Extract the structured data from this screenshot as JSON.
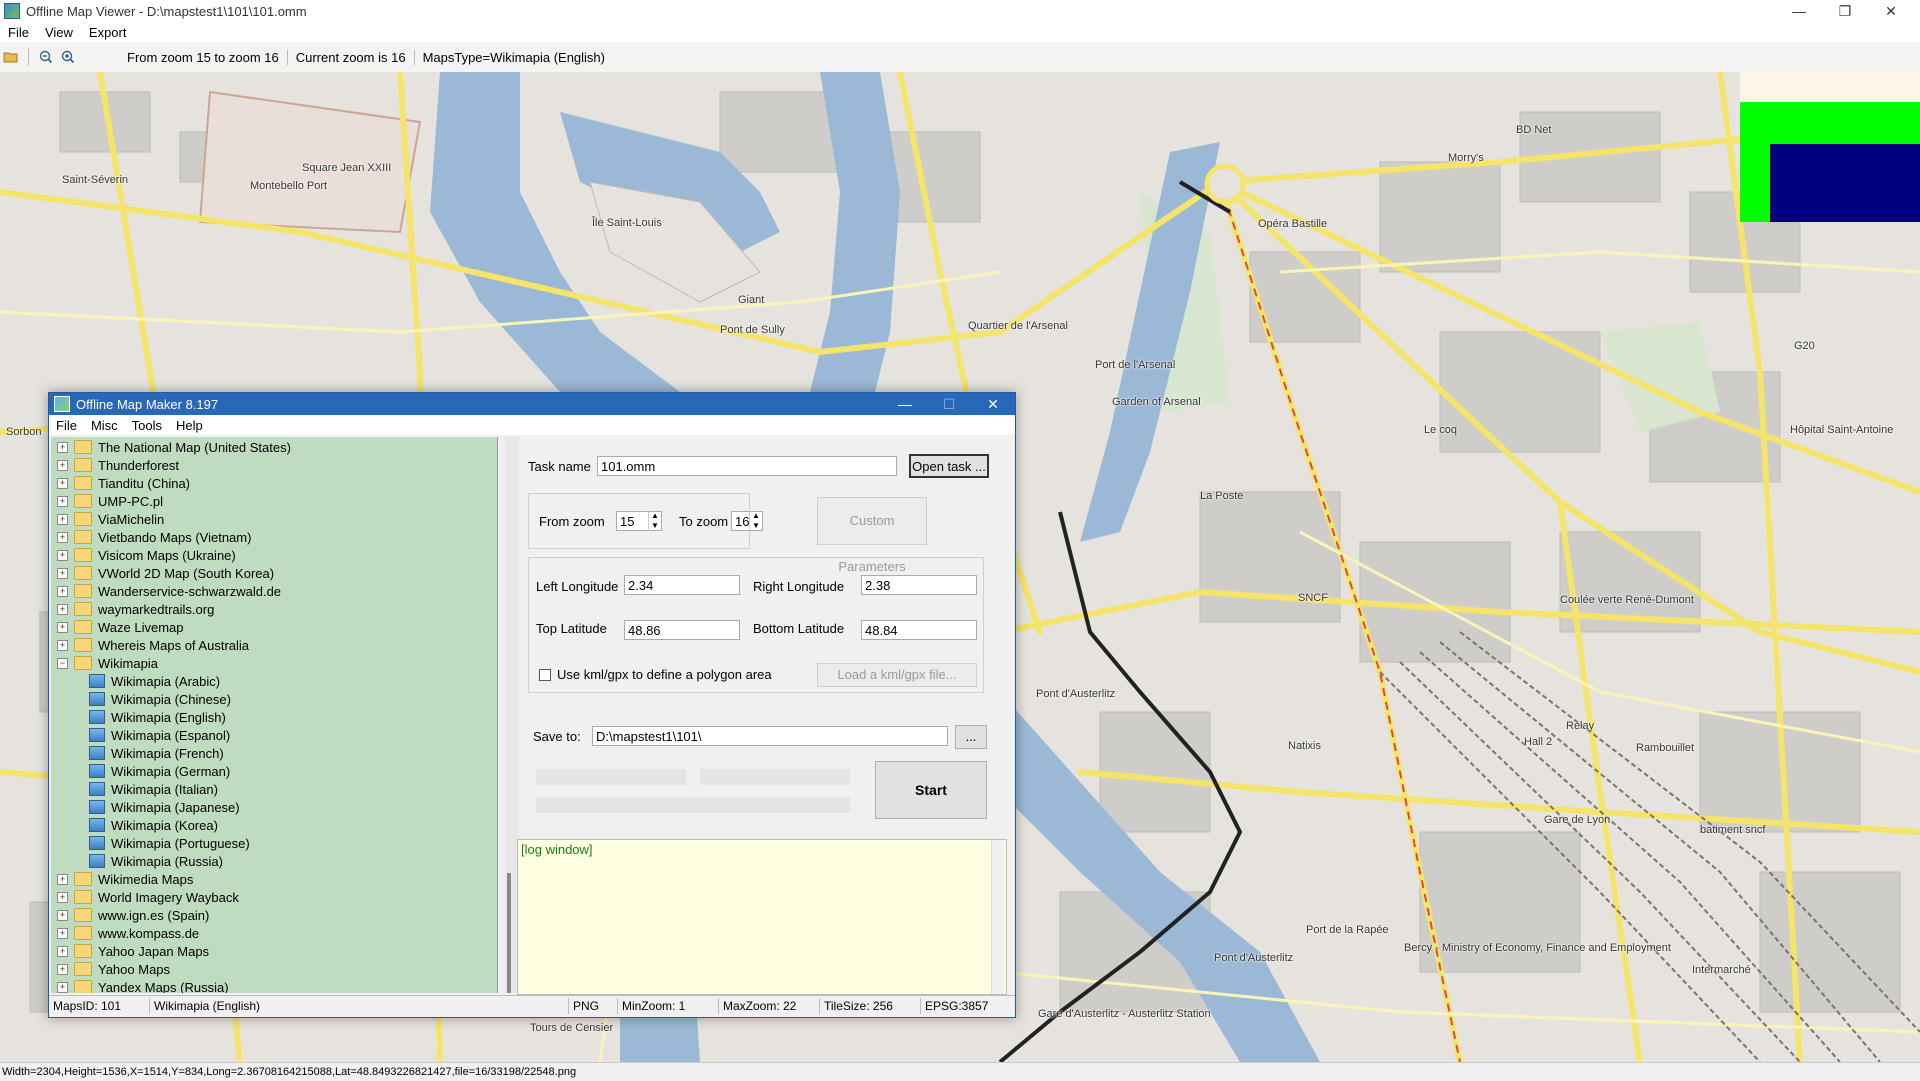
{
  "window": {
    "title": "Offline Map Viewer - D:\\mapstest1\\101\\101.omm",
    "minimize": "—",
    "maximize": "❐",
    "close": "✕"
  },
  "menu": [
    "File",
    "View",
    "Export"
  ],
  "toolbar": {
    "open_icon": "folder-open-icon",
    "zoom_out_icon": "zoom-out-icon",
    "zoom_in_icon": "zoom-in-icon",
    "zoom_range": "From zoom 15 to zoom 16",
    "current_zoom": "Current zoom is 16",
    "maps_type": "MapsType=Wikimapia (English)"
  },
  "map_labels": {
    "square_jean": "Square Jean XXIII",
    "saint_severin": "Saint-Séverin",
    "montebello": "Montebello Port",
    "ile_saint_louis": "Île Saint-Louis",
    "giant": "Giant",
    "pont_sully": "Pont de Sully",
    "quartier_arsenal": "Quartier de l'Arsenal",
    "port_arsenal": "Port de l'Arsenal",
    "garden_arsenal": "Garden of Arsenal",
    "opera_bastille": "Opéra Bastille",
    "bd_net": "BD Net",
    "morrys": "Morry's",
    "g20": "G20",
    "hopital": "Hôpital Saint-Antoine",
    "le_coq": "Le coq",
    "la_poste": "La Poste",
    "sncf": "SNCF",
    "coulee_verte": "Coulée verte René-Dumont",
    "pont_austerlitz_1": "Pont d'Austerlitz",
    "natixis": "Natixis",
    "relay": "Relay",
    "hall_2": "Hall 2",
    "rambouillet": "Rambouillet",
    "gare_lyon": "Gare de Lyon",
    "batiment": "batiment sncf",
    "port_rapee": "Port de la Rapée",
    "bercy": "Bercy - Ministry of Economy, Finance and Employment",
    "pont_austerlitz_2": "Pont d'Austerlitz",
    "intermarche": "Intermarché",
    "gare_austerlitz": "Gare d'Austerlitz - Austerlitz Station",
    "tours_censier": "Tours de Censier",
    "sorbonne": "Sorbon"
  },
  "status": "Width=2304,Height=1536,X=1514,Y=834,Long=2.36708164215088,Lat=48.8493226821427,file=16/33198/22548.png",
  "maker": {
    "title": "Offline Map Maker 8.197",
    "minimize": "—",
    "maximize": "☐",
    "close": "✕",
    "menu": [
      "File",
      "Misc",
      "Tools",
      "Help"
    ],
    "tree": [
      {
        "label": "The National Map (United States)",
        "kind": "folder"
      },
      {
        "label": "Thunderforest",
        "kind": "folder"
      },
      {
        "label": "Tianditu (China)",
        "kind": "folder"
      },
      {
        "label": "UMP-PC.pl",
        "kind": "folder"
      },
      {
        "label": "ViaMichelin",
        "kind": "folder"
      },
      {
        "label": "Vietbando Maps (Vietnam)",
        "kind": "folder"
      },
      {
        "label": "Visicom Maps (Ukraine)",
        "kind": "folder"
      },
      {
        "label": "VWorld 2D Map (South Korea)",
        "kind": "folder"
      },
      {
        "label": "Wanderservice-schwarzwald.de",
        "kind": "folder"
      },
      {
        "label": "waymarkedtrails.org",
        "kind": "folder"
      },
      {
        "label": "Waze Livemap",
        "kind": "folder"
      },
      {
        "label": "Whereis Maps of Australia",
        "kind": "folder"
      },
      {
        "label": "Wikimapia",
        "kind": "open"
      },
      {
        "label": "Wikimapia (Arabic)",
        "kind": "leaf"
      },
      {
        "label": "Wikimapia (Chinese)",
        "kind": "leaf"
      },
      {
        "label": "Wikimapia (English)",
        "kind": "leaf"
      },
      {
        "label": "Wikimapia (Espanol)",
        "kind": "leaf"
      },
      {
        "label": "Wikimapia (French)",
        "kind": "leaf"
      },
      {
        "label": "Wikimapia (German)",
        "kind": "leaf"
      },
      {
        "label": "Wikimapia (Italian)",
        "kind": "leaf"
      },
      {
        "label": "Wikimapia (Japanese)",
        "kind": "leaf"
      },
      {
        "label": "Wikimapia (Korea)",
        "kind": "leaf"
      },
      {
        "label": "Wikimapia (Portuguese)",
        "kind": "leaf"
      },
      {
        "label": "Wikimapia (Russia)",
        "kind": "leaf"
      },
      {
        "label": "Wikimedia Maps",
        "kind": "folder"
      },
      {
        "label": "World Imagery Wayback",
        "kind": "folder"
      },
      {
        "label": "www.ign.es (Spain)",
        "kind": "folder"
      },
      {
        "label": "www.kompass.de",
        "kind": "folder"
      },
      {
        "label": "Yahoo Japan Maps",
        "kind": "folder"
      },
      {
        "label": "Yahoo Maps",
        "kind": "folder"
      },
      {
        "label": "Yandex Maps (Russia)",
        "kind": "folder"
      }
    ],
    "form": {
      "task_name_label": "Task name",
      "task_name_value": "101.omm",
      "open_task_button": "Open task ...",
      "from_zoom_label": "From zoom",
      "from_zoom_value": "15",
      "to_zoom_label": "To zoom",
      "to_zoom_value": "16",
      "custom_params_button": "Custom Parameters",
      "left_lon_label": "Left Longitude",
      "left_lon_value": "2.34",
      "right_lon_label": "Right Longitude",
      "right_lon_value": "2.38",
      "top_lat_label": "Top Latitude",
      "top_lat_value": "48.86",
      "bottom_lat_label": "Bottom Latitude",
      "bottom_lat_value": "48.84",
      "kml_label": "Use kml/gpx to define a polygon area",
      "load_kml_button": "Load a kml/gpx file...",
      "save_to_label": "Save to:",
      "save_to_value": "D:\\mapstest1\\101\\",
      "browse_button": "...",
      "start_button": "Start",
      "log_text": "[log window]"
    },
    "status": {
      "maps_id": "MapsID: 101",
      "maps_name": "Wikimapia (English)",
      "format": "PNG",
      "min_zoom": "MinZoom: 1",
      "max_zoom": "MaxZoom: 22",
      "tile_size": "TileSize: 256",
      "epsg": "EPSG:3857"
    }
  }
}
